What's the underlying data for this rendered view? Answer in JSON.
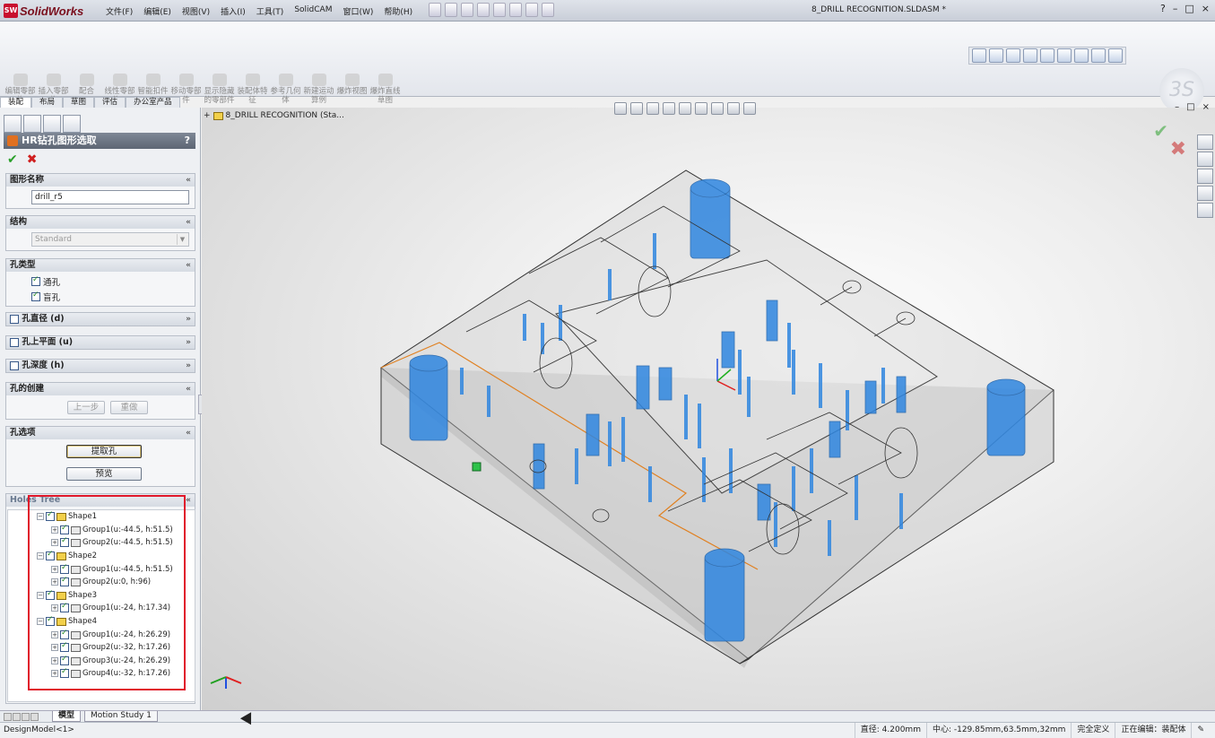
{
  "app": {
    "name": "SolidWorks",
    "logo_text": "SW"
  },
  "menu": [
    "文件(F)",
    "编辑(E)",
    "视图(V)",
    "插入(I)",
    "工具(T)",
    "SolidCAM",
    "窗口(W)",
    "帮助(H)"
  ],
  "document_title": "8_DRILL RECOGNITION.SLDASM *",
  "window_controls": {
    "help": "?",
    "minimize": "–",
    "restore": "□",
    "close": "×"
  },
  "commands": [
    {
      "label": "编辑零部件"
    },
    {
      "label": "插入零部件"
    },
    {
      "label": "配合"
    },
    {
      "label": "线性零部件..."
    },
    {
      "label": "智能扣件"
    },
    {
      "label": "移动零部件"
    },
    {
      "label": "显示隐藏的零部件"
    },
    {
      "label": "装配体特征"
    },
    {
      "label": "参考几何体"
    },
    {
      "label": "新建运动算例"
    },
    {
      "label": "爆炸视图"
    },
    {
      "label": "爆炸直线草图"
    }
  ],
  "cmd_tabs": [
    "装配",
    "布局",
    "草图",
    "评估",
    "办公室产品"
  ],
  "property_manager": {
    "title": "HR钻孔图形选取",
    "help": "?",
    "ok": "✔",
    "cancel": "✖",
    "sections": {
      "shape_name": {
        "title": "图形名称",
        "value": "drill_r5"
      },
      "structure": {
        "title": "结构",
        "value": "Standard"
      },
      "hole_type": {
        "title": "孔类型",
        "options": [
          {
            "label": "通孔",
            "checked": true
          },
          {
            "label": "盲孔",
            "checked": true
          }
        ]
      },
      "diameter": {
        "title": "孔直径 (d)"
      },
      "top_face": {
        "title": "孔上平面 (u)"
      },
      "depth": {
        "title": "孔深度 (h)"
      },
      "creation": {
        "title": "孔的创建",
        "prev": "上一步",
        "reset": "重做"
      },
      "options": {
        "title": "孔选项",
        "extract": "提取孔",
        "preview": "预览"
      },
      "holes_tree": {
        "title": "Holes Tree"
      }
    }
  },
  "holes_tree": [
    {
      "shape": "Shape1",
      "groups": [
        "Group1(u:-44.5, h:51.5)",
        "Group2(u:-44.5, h:51.5)"
      ]
    },
    {
      "shape": "Shape2",
      "groups": [
        "Group1(u:-44.5, h:51.5)",
        "Group2(u:0, h:96)"
      ]
    },
    {
      "shape": "Shape3",
      "groups": [
        "Group1(u:-24, h:17.34)"
      ]
    },
    {
      "shape": "Shape4",
      "groups": [
        "Group1(u:-24, h:26.29)",
        "Group2(u:-32, h:17.26)",
        "Group3(u:-24, h:26.29)",
        "Group4(u:-32, h:17.26)"
      ]
    }
  ],
  "viewport": {
    "root_node": "8_DRILL RECOGNITION (Sta..."
  },
  "bottom_tabs": [
    "模型",
    "Motion Study 1"
  ],
  "status": {
    "left": "DesignModel<1>",
    "diameter": "直径: 4.200mm",
    "center": "中心: -129.85mm,63.5mm,32mm",
    "defined": "完全定义",
    "editing": "正在编辑：装配体"
  },
  "colors": {
    "hole_fill": "#2f86e0",
    "selection_box": "#e0182b",
    "edge_highlight": "#e08020"
  }
}
